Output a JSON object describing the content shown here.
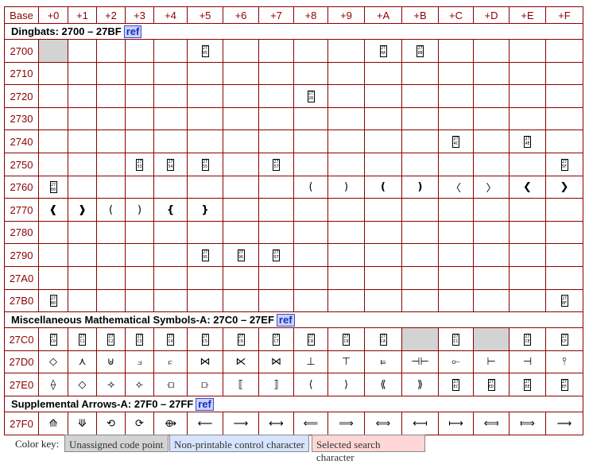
{
  "header": {
    "base": "Base",
    "columns": [
      "+0",
      "+1",
      "+2",
      "+3",
      "+4",
      "+5",
      "+6",
      "+7",
      "+8",
      "+9",
      "+A",
      "+B",
      "+C",
      "+D",
      "+E",
      "+F"
    ]
  },
  "sections": [
    {
      "title": "Dingbats: 2700 – 27BF",
      "ref": "ref",
      "rows": [
        {
          "base": "2700",
          "cells": [
            {
              "gray": true
            },
            {},
            {},
            {},
            {},
            {
              "box": [
                "27",
                "05"
              ]
            },
            {},
            {},
            {},
            {},
            {
              "box": [
                "27",
                "0A"
              ]
            },
            {
              "box": [
                "27",
                "0B"
              ]
            },
            {},
            {},
            {},
            {}
          ]
        },
        {
          "base": "2710",
          "cells": [
            {},
            {},
            {},
            {},
            {},
            {},
            {},
            {},
            {},
            {},
            {},
            {},
            {},
            {},
            {},
            {}
          ]
        },
        {
          "base": "2720",
          "cells": [
            {},
            {},
            {},
            {},
            {},
            {},
            {},
            {},
            {
              "box": [
                "27",
                "28"
              ]
            },
            {},
            {},
            {},
            {},
            {},
            {},
            {}
          ]
        },
        {
          "base": "2730",
          "cells": [
            {},
            {},
            {},
            {},
            {},
            {},
            {},
            {},
            {},
            {},
            {},
            {},
            {},
            {},
            {},
            {}
          ]
        },
        {
          "base": "2740",
          "cells": [
            {},
            {},
            {},
            {},
            {},
            {},
            {},
            {},
            {},
            {},
            {},
            {},
            {
              "box": [
                "27",
                "4C"
              ]
            },
            {},
            {
              "box": [
                "27",
                "4E"
              ]
            },
            {}
          ]
        },
        {
          "base": "2750",
          "cells": [
            {},
            {},
            {},
            {
              "box": [
                "27",
                "53"
              ]
            },
            {
              "box": [
                "27",
                "54"
              ]
            },
            {
              "box": [
                "27",
                "55"
              ]
            },
            {},
            {
              "box": [
                "27",
                "57"
              ]
            },
            {},
            {},
            {},
            {},
            {},
            {},
            {},
            {
              "box": [
                "27",
                "5F"
              ]
            }
          ]
        },
        {
          "base": "2760",
          "cells": [
            {
              "box": [
                "27",
                "60"
              ]
            },
            {},
            {},
            {},
            {},
            {},
            {},
            {},
            {
              "ch": "("
            },
            {
              "ch": ")"
            },
            {
              "ch": "(",
              "bold": true
            },
            {
              "ch": ")",
              "bold": true
            },
            {
              "ch": "〈"
            },
            {
              "ch": "〉"
            },
            {
              "ch": "❮",
              "bold": true
            },
            {
              "ch": "❯",
              "bold": true
            }
          ]
        },
        {
          "base": "2770",
          "cells": [
            {
              "ch": "❰",
              "bold": true
            },
            {
              "ch": "❱",
              "bold": true
            },
            {
              "ch": "("
            },
            {
              "ch": ")"
            },
            {
              "ch": "{",
              "bold": true
            },
            {
              "ch": "}",
              "bold": true
            },
            {},
            {},
            {},
            {},
            {},
            {},
            {},
            {},
            {},
            {}
          ]
        },
        {
          "base": "2780",
          "cells": [
            {},
            {},
            {},
            {},
            {},
            {},
            {},
            {},
            {},
            {},
            {},
            {},
            {},
            {},
            {},
            {}
          ]
        },
        {
          "base": "2790",
          "cells": [
            {},
            {},
            {},
            {},
            {},
            {
              "box": [
                "27",
                "95"
              ]
            },
            {
              "box": [
                "27",
                "96"
              ]
            },
            {
              "box": [
                "27",
                "97"
              ]
            },
            {},
            {},
            {},
            {},
            {},
            {},
            {},
            {}
          ]
        },
        {
          "base": "27A0",
          "cells": [
            {},
            {},
            {},
            {},
            {},
            {},
            {},
            {},
            {},
            {},
            {},
            {},
            {},
            {},
            {},
            {}
          ]
        },
        {
          "base": "27B0",
          "cells": [
            {
              "box": [
                "27",
                "B0"
              ]
            },
            {},
            {},
            {},
            {},
            {},
            {},
            {},
            {},
            {},
            {},
            {},
            {},
            {},
            {},
            {
              "box": [
                "27",
                "BF"
              ]
            }
          ]
        }
      ]
    },
    {
      "title": "Miscellaneous Mathematical Symbols-A: 27C0 – 27EF",
      "ref": "ref",
      "rows": [
        {
          "base": "27C0",
          "cells": [
            {
              "box": [
                "27",
                "C0"
              ]
            },
            {
              "box": [
                "27",
                "C1"
              ]
            },
            {
              "box": [
                "27",
                "C2"
              ]
            },
            {
              "box": [
                "27",
                "C3"
              ]
            },
            {
              "box": [
                "27",
                "C4"
              ]
            },
            {
              "box": [
                "27",
                "C5"
              ]
            },
            {
              "box": [
                "27",
                "C6"
              ]
            },
            {
              "box": [
                "27",
                "C7"
              ]
            },
            {
              "box": [
                "27",
                "C8"
              ]
            },
            {
              "box": [
                "27",
                "C9"
              ]
            },
            {
              "box": [
                "27",
                "CA"
              ]
            },
            {
              "gray": true
            },
            {
              "box": [
                "27",
                "CC"
              ]
            },
            {
              "gray": true
            },
            {
              "box": [
                "27",
                "CE"
              ]
            },
            {
              "box": [
                "27",
                "CF"
              ]
            }
          ]
        },
        {
          "base": "27D0",
          "cells": [
            {
              "ch": "◇"
            },
            {
              "ch": "⋏"
            },
            {
              "ch": "⊎"
            },
            {
              "ch": "⟓"
            },
            {
              "ch": "⟔"
            },
            {
              "ch": "⋈"
            },
            {
              "ch": "⋉"
            },
            {
              "ch": "⋈"
            },
            {
              "ch": "⊥"
            },
            {
              "ch": "⊤"
            },
            {
              "ch": "⫢"
            },
            {
              "ch": "⊣⊢"
            },
            {
              "ch": "⟜"
            },
            {
              "ch": "⊢"
            },
            {
              "ch": "⊣"
            },
            {
              "ch": "⫯"
            }
          ]
        },
        {
          "base": "27E0",
          "cells": [
            {
              "ch": "⟠"
            },
            {
              "ch": "◇"
            },
            {
              "ch": "⟢"
            },
            {
              "ch": "⟣"
            },
            {
              "ch": "⟤"
            },
            {
              "ch": "⟥"
            },
            {
              "ch": "⟦"
            },
            {
              "ch": "⟧"
            },
            {
              "ch": "⟨"
            },
            {
              "ch": "⟩"
            },
            {
              "ch": "⟪"
            },
            {
              "ch": "⟫"
            },
            {
              "box": [
                "27",
                "EC"
              ]
            },
            {
              "box": [
                "27",
                "ED"
              ]
            },
            {
              "box": [
                "27",
                "EE"
              ]
            },
            {
              "box": [
                "27",
                "EF"
              ]
            }
          ]
        }
      ]
    },
    {
      "title": "Supplemental Arrows-A: 27F0 – 27FF",
      "ref": "ref",
      "rows": [
        {
          "base": "27F0",
          "cells": [
            {
              "ch": "⟰"
            },
            {
              "ch": "⟱"
            },
            {
              "ch": "⟲"
            },
            {
              "ch": "⟳"
            },
            {
              "ch": "⟴"
            },
            {
              "ch": "⟵"
            },
            {
              "ch": "⟶"
            },
            {
              "ch": "⟷"
            },
            {
              "ch": "⟸"
            },
            {
              "ch": "⟹"
            },
            {
              "ch": "⟺"
            },
            {
              "ch": "⟻"
            },
            {
              "ch": "⟼"
            },
            {
              "ch": "⟽"
            },
            {
              "ch": "⟾"
            },
            {
              "ch": "⟿"
            }
          ]
        }
      ]
    }
  ],
  "legend": {
    "label": "Color key:",
    "items": [
      {
        "text": "Unassigned code point",
        "bg": "#d3d3d3"
      },
      {
        "text": "Non-printable control character",
        "bg": "#d6e4ff"
      },
      {
        "text": "Selected search character",
        "bg": "#ffd6d6"
      }
    ]
  },
  "colors": {
    "border": "#8b0000",
    "gray": "#d3d3d3",
    "ref_bg": "#c8d2ff"
  }
}
